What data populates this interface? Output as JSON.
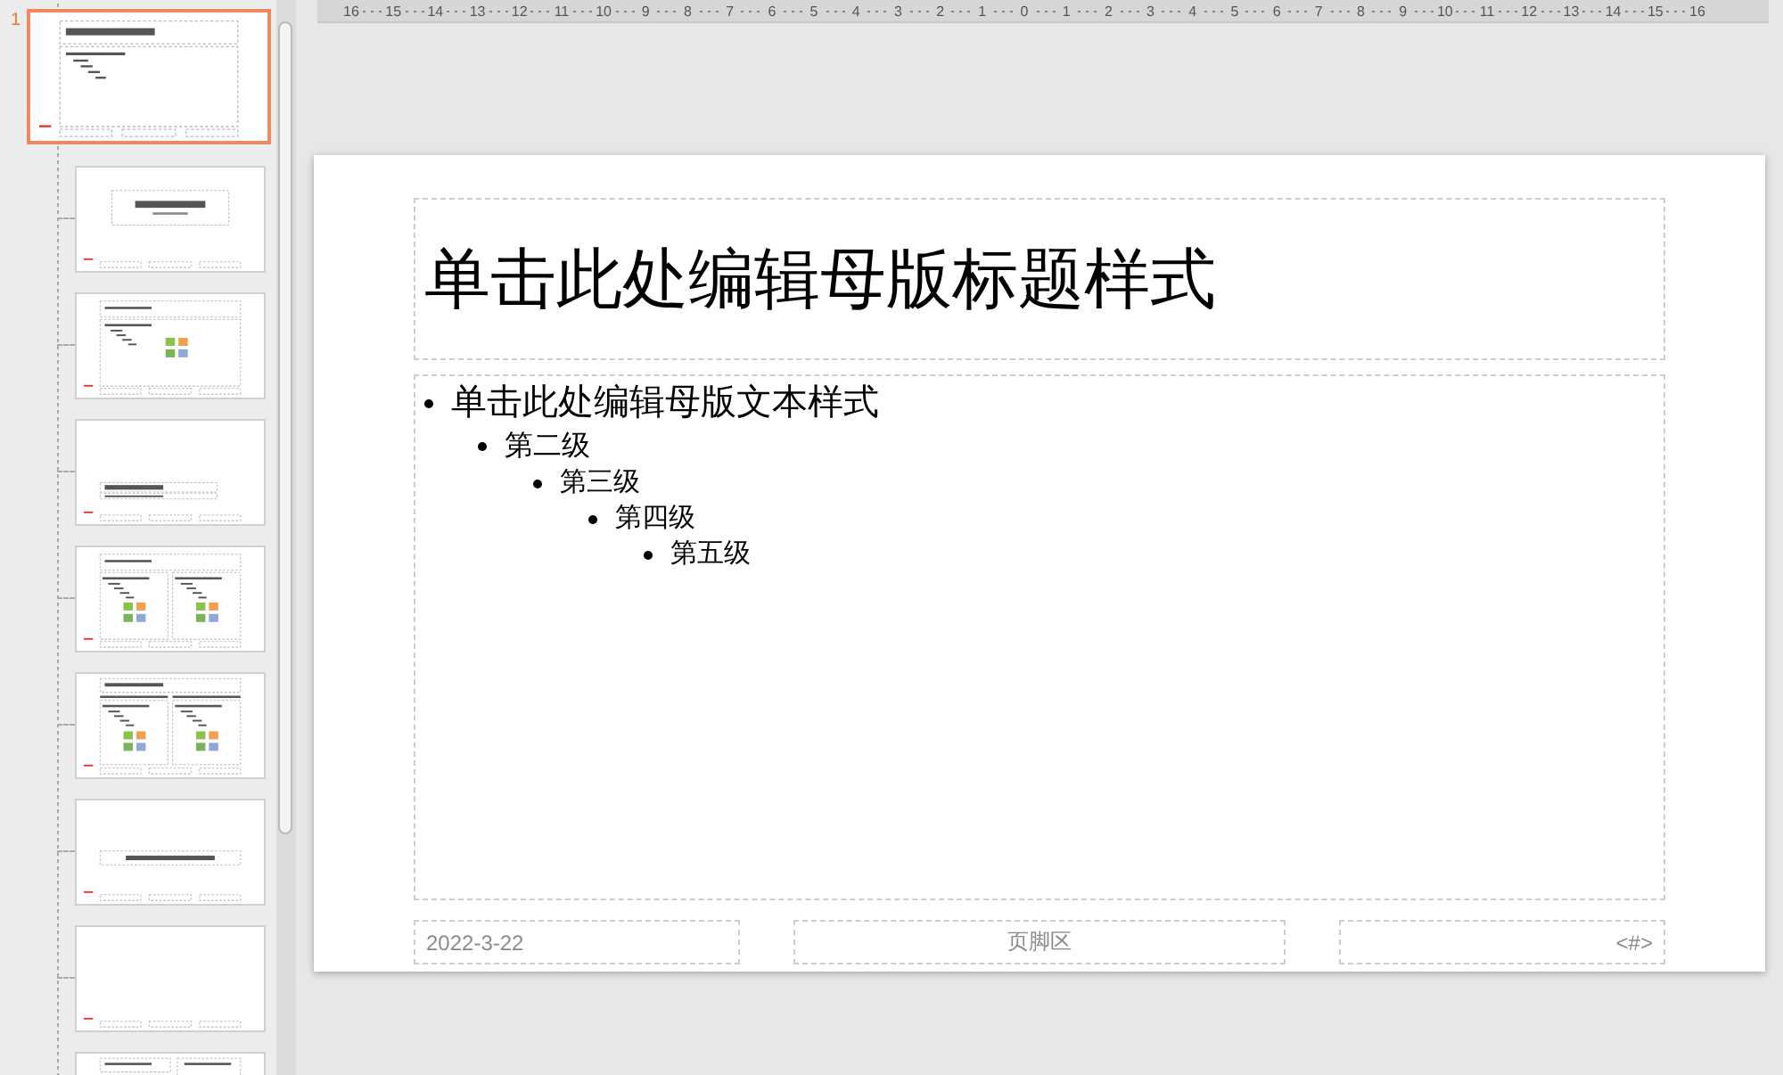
{
  "ruler": {
    "labels": [
      "16",
      "15",
      "14",
      "13",
      "12",
      "11",
      "10",
      "9",
      "8",
      "7",
      "6",
      "5",
      "4",
      "3",
      "2",
      "1",
      "0",
      "1",
      "2",
      "3",
      "4",
      "5",
      "6",
      "7",
      "8",
      "9",
      "10",
      "11",
      "12",
      "13",
      "14",
      "15",
      "16"
    ]
  },
  "thumbnails": [
    {
      "number": "1",
      "kind": "master",
      "selected": true
    },
    {
      "kind": "title",
      "selected": false
    },
    {
      "kind": "content",
      "selected": false
    },
    {
      "kind": "section",
      "selected": false
    },
    {
      "kind": "two",
      "selected": false
    },
    {
      "kind": "comparison",
      "selected": false
    },
    {
      "kind": "title-only",
      "selected": false
    },
    {
      "kind": "blank",
      "selected": false
    },
    {
      "kind": "caption",
      "selected": false
    }
  ],
  "slide": {
    "title": "单击此处编辑母版标题样式",
    "body": [
      {
        "text": "单击此处编辑母版文本样式",
        "children": [
          {
            "text": "第二级",
            "children": [
              {
                "text": "第三级",
                "children": [
                  {
                    "text": "第四级",
                    "children": [
                      {
                        "text": "第五级"
                      }
                    ]
                  }
                ]
              }
            ]
          }
        ]
      }
    ],
    "footer": {
      "date": "2022-3-22",
      "footer": "页脚区",
      "number": "<#>"
    }
  }
}
